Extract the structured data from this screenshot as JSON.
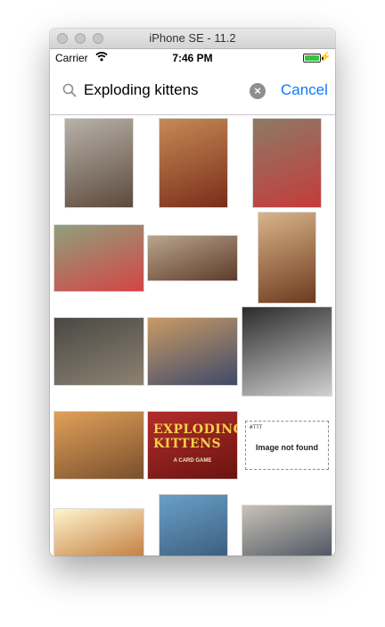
{
  "window": {
    "title": "iPhone SE - 11.2"
  },
  "status": {
    "carrier": "Carrier",
    "time": "7:46 PM",
    "battery_level": 1.0
  },
  "search": {
    "query": "Exploding kittens",
    "cancel_label": "Cancel"
  },
  "results": {
    "not_found_text": "Image not found",
    "not_found_tag": "#TTT",
    "box_title": "EXPLODING KITTENS",
    "box_subtitle": "A CARD GAME",
    "items": [
      {
        "name": "dinner-party-photo",
        "colors": [
          "#b8b2a9",
          "#5c4a3c"
        ]
      },
      {
        "name": "pizza-photo",
        "colors": [
          "#c68a55",
          "#7a2d1a"
        ]
      },
      {
        "name": "card-table-photo",
        "colors": [
          "#8d7a65",
          "#c53b3b"
        ]
      },
      {
        "name": "playing-cards-photo",
        "colors": [
          "#8fa07c",
          "#d44545"
        ]
      },
      {
        "name": "people-at-table-photo",
        "colors": [
          "#b9a58d",
          "#5e3b2a"
        ]
      },
      {
        "name": "dog-photo",
        "colors": [
          "#d9b48a",
          "#6e3a1e"
        ]
      },
      {
        "name": "living-room-photo",
        "colors": [
          "#4a4844",
          "#8c8272"
        ]
      },
      {
        "name": "kids-game-photo",
        "colors": [
          "#c99a65",
          "#3e4a6a"
        ]
      },
      {
        "name": "black-white-cat-photo",
        "colors": [
          "#2c2c2c",
          "#d0d0d0"
        ]
      },
      {
        "name": "orange-cat-photo",
        "colors": [
          "#e0a15a",
          "#7a4f2c"
        ]
      },
      {
        "name": "exploding-kittens-box-photo",
        "colors": [
          "#b32d2a",
          "#6a1411"
        ]
      },
      {
        "name": "image-not-found-placeholder",
        "colors": [
          "#ffffff",
          "#ffffff"
        ]
      },
      {
        "name": "calico-cat-photo",
        "colors": [
          "#fff4cc",
          "#c0793a"
        ]
      },
      {
        "name": "umbrella-photo",
        "colors": [
          "#6aa0c8",
          "#3d5f80"
        ]
      },
      {
        "name": "group-table-photo",
        "colors": [
          "#c9c2b6",
          "#4e5663"
        ]
      }
    ]
  }
}
